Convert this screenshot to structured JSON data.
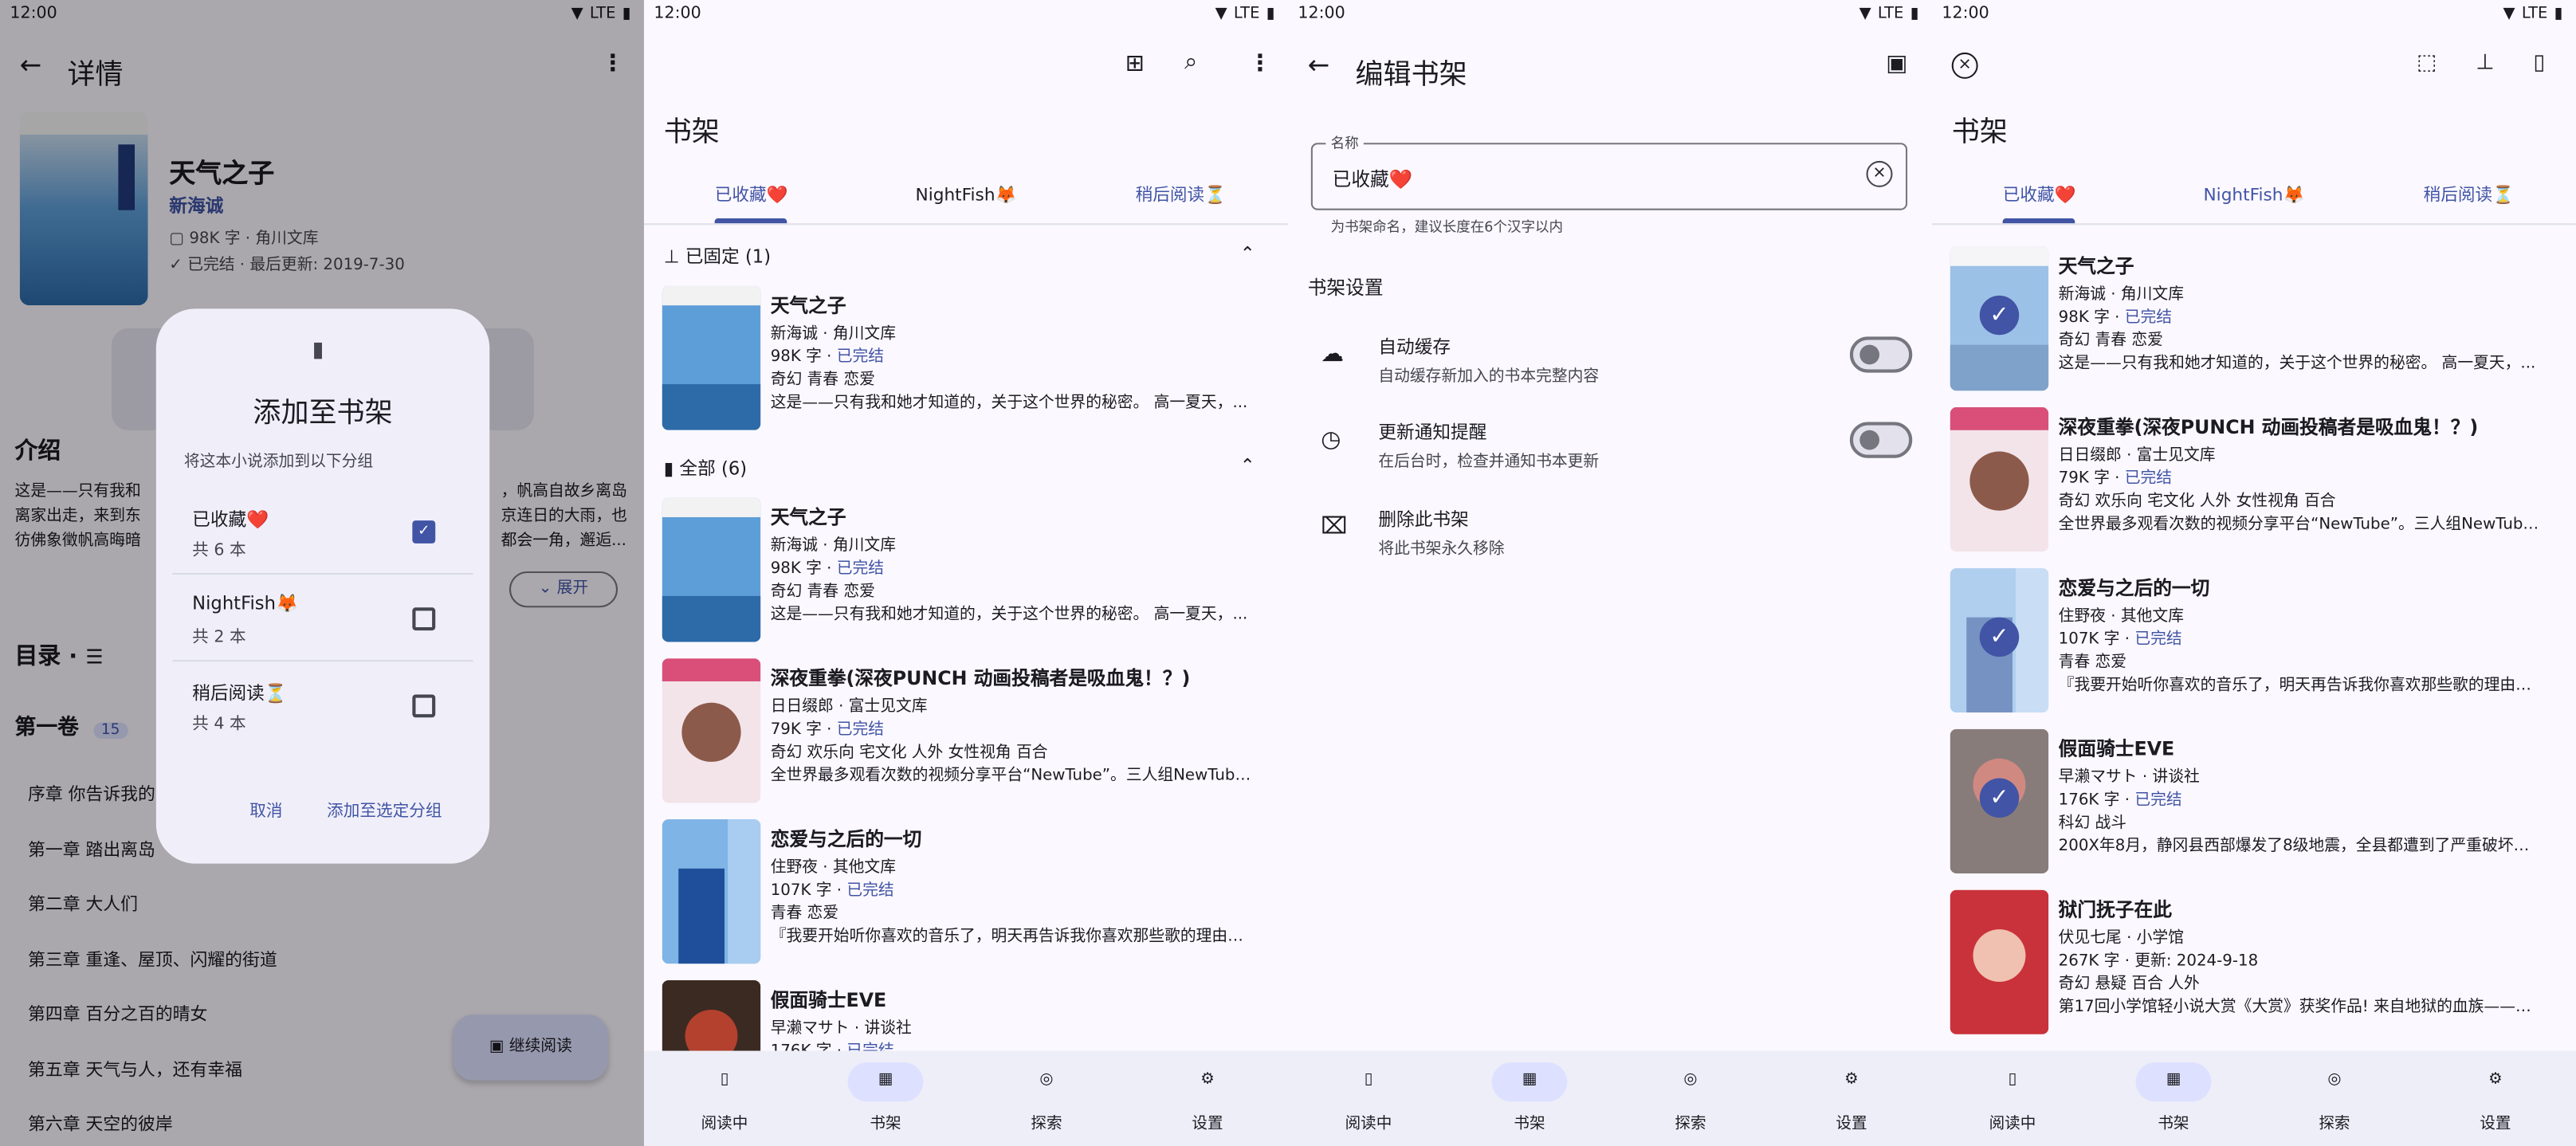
{
  "status": {
    "time": "12:00",
    "network": "LTE"
  },
  "colors": {
    "accent": "#4154a5",
    "surface": "#fbf8ff",
    "nav": "#eeeef8",
    "sel_pill": "#dde1ff"
  },
  "nav": {
    "items": [
      "阅读中",
      "书架",
      "探索",
      "设置"
    ]
  },
  "tabs": [
    "已收藏❤️",
    "NightFish🦊",
    "稍后阅读⏳"
  ],
  "books": {
    "tianqi": {
      "title": "天气之子",
      "author": "新海诚 · 角川文库",
      "words": "98K 字 · ",
      "status": "已完结",
      "tags": "奇幻 青春 恋爱",
      "desc": "这是——只有我和她才知道的，关于这个世界的秘密。 高一夏天，..."
    },
    "shenye": {
      "title": "深夜重拳(深夜PUNCH 动画投稿者是吸血鬼！？)",
      "author": "日日缀郎 · 富士见文库",
      "words": "79K 字 · ",
      "status": "已完结",
      "tags": "奇幻 欢乐向 宅文化 人外 女性视角 百合",
      "desc": "全世界最多观看次数的视频分享平台“NewTube”。三人组NewTuber”..."
    },
    "lianai": {
      "title": "恋爱与之后的一切",
      "author": "住野夜 · 其他文库",
      "words": "107K 字 · ",
      "status": "已完结",
      "tags": "青春 恋爱",
      "desc": "『我要开始听你喜欢的音乐了，明天再告诉我你喜欢那些歌的理由。..."
    },
    "jiamian": {
      "title": "假面骑士EVE",
      "author": "早濑マサト · 讲谈社",
      "words": "176K 字 · ",
      "status": "已完结",
      "tags": "科幻 战斗",
      "desc": "200X年8月，静冈县西部爆发了8级地震，全县都遭到了严重破坏。..."
    },
    "yumen": {
      "title": "狱门抚子在此",
      "author": "伏见七尾 · 小学馆",
      "words": "267K 字 · 更新: 2024-9-18",
      "tags": "奇幻 悬疑 百合 人外",
      "desc": "第17回小学馆轻小说大赏《大赏》获奖作品! 来自地狱的血族——狱..."
    }
  },
  "panel1": {
    "header": "详情",
    "book_title": "天气之子",
    "author": "新海诚",
    "meta1": "98K 字 · 角川文库",
    "meta2": "已完结 · 最后更新: 2019-7-30",
    "intro_label": "介绍",
    "intro_lines": [
      "这是——只有我和",
      "离家出走，来到东",
      "彷佛象徵帆高晦暗"
    ],
    "intro_right": [
      "，帆高自故乡离岛",
      "京连日的大雨，也",
      "都会一角，邂逅..."
    ],
    "expand": "展开",
    "toc_label": "目录 ·",
    "volume": "第一卷",
    "volume_count": "15",
    "chapters": [
      "序章 你告诉我的",
      "第一章 踏出离岛",
      "第二章 大人们",
      "第三章 重逢、屋顶、闪耀的街道",
      "第四章 百分之百的晴女",
      "第五章 天气与人，还有幸福",
      "第六章 天空的彼岸"
    ],
    "continue": "继续阅读",
    "dialog": {
      "title": "添加至书架",
      "subtitle": "将这本小说添加到以下分组",
      "groups": [
        {
          "name": "已收藏❤️",
          "count": "共 6 本",
          "checked": true
        },
        {
          "name": "NightFish🦊",
          "count": "共 2 本",
          "checked": false
        },
        {
          "name": "稍后阅读⏳",
          "count": "共 4 本",
          "checked": false
        }
      ],
      "cancel": "取消",
      "confirm": "添加至选定分组"
    }
  },
  "panel2": {
    "title": "书架",
    "pinned": "已固定 (1)",
    "all": "全部 (6)"
  },
  "panel3": {
    "header": "编辑书架",
    "field_label": "名称",
    "field_value": "已收藏❤️",
    "field_hint": "为书架命名，建议长度在6个汉字以内",
    "section": "书架设置",
    "settings": [
      {
        "title": "自动缓存",
        "desc": "自动缓存新加入的书本完整内容"
      },
      {
        "title": "更新通知提醒",
        "desc": "在后台时，检查并通知书本更新"
      },
      {
        "title": "删除此书架",
        "desc": "将此书架永久移除"
      }
    ]
  },
  "panel4": {
    "title": "书架"
  }
}
